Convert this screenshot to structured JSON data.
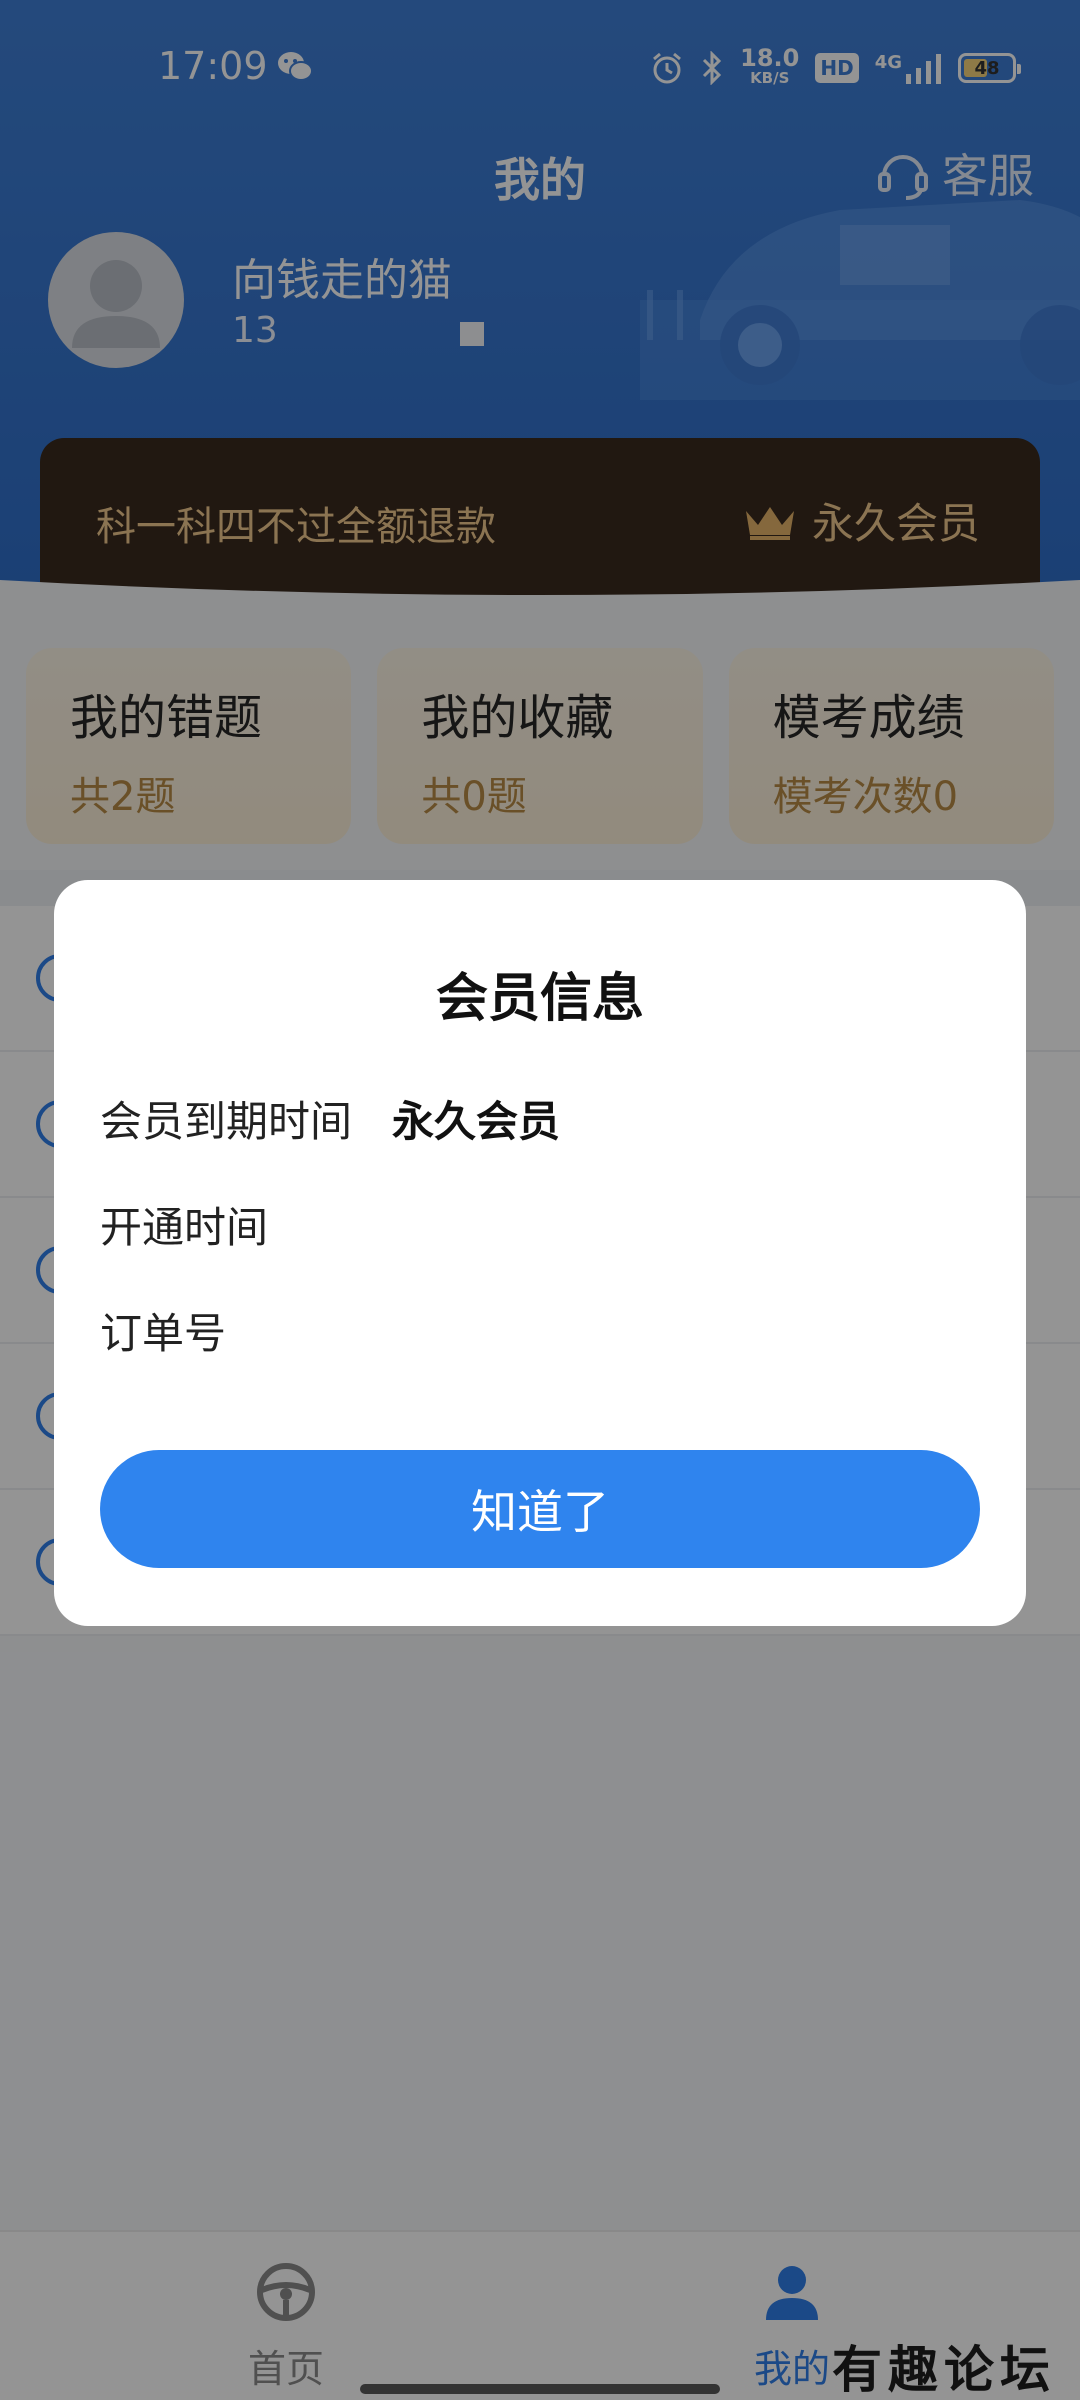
{
  "status_bar": {
    "time": "17:09",
    "network_speed_value": "18.0",
    "network_speed_unit": "KB/S",
    "hd_label": "HD",
    "signal_label": "4G",
    "battery_level": "48"
  },
  "header": {
    "title": "我的",
    "support_label": "客服"
  },
  "user": {
    "name": "向钱走的猫",
    "phone": "13"
  },
  "vip_banner": {
    "slogan": "科一科四不过全额退款",
    "status": "永久会员"
  },
  "cards": [
    {
      "title": "我的错题",
      "subtitle": "共2题"
    },
    {
      "title": "我的收藏",
      "subtitle": "共0题"
    },
    {
      "title": "模考成绩",
      "subtitle": "模考次数0"
    }
  ],
  "modal": {
    "title": "会员信息",
    "rows": [
      {
        "label": "会员到期时间",
        "value": "永久会员"
      },
      {
        "label": "开通时间",
        "value": ""
      },
      {
        "label": "订单号",
        "value": ""
      }
    ],
    "ok_label": "知道了"
  },
  "bottom_nav": {
    "home_label": "首页",
    "mine_label": "我的"
  },
  "watermark": "有趣论坛",
  "colors": {
    "primary_blue": "#2f84ee",
    "header_blue": "#3f7fd6",
    "vip_banner_bg": "#3a2a1e",
    "vip_gold": "#f0c98e",
    "card_sub_gold": "#b78a46"
  }
}
